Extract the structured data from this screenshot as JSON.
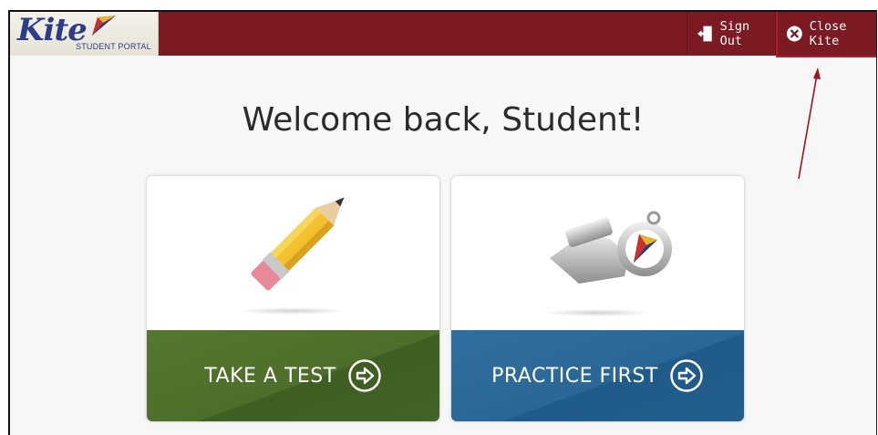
{
  "header": {
    "logo_word": "Kite",
    "logo_subtitle": "STUDENT PORTAL",
    "sign_out_label": "Sign Out",
    "close_label": "Close Kite"
  },
  "main": {
    "welcome": "Welcome back, Student!",
    "cards": [
      {
        "label": "TAKE A TEST",
        "icon": "pencil-icon"
      },
      {
        "label": "PRACTICE FIRST",
        "icon": "whistle-icon"
      }
    ]
  },
  "colors": {
    "header_bg": "#7c1a24",
    "test_band": "#4e6e2b",
    "practice_band": "#2a6796",
    "annotation": "#b0202a"
  }
}
